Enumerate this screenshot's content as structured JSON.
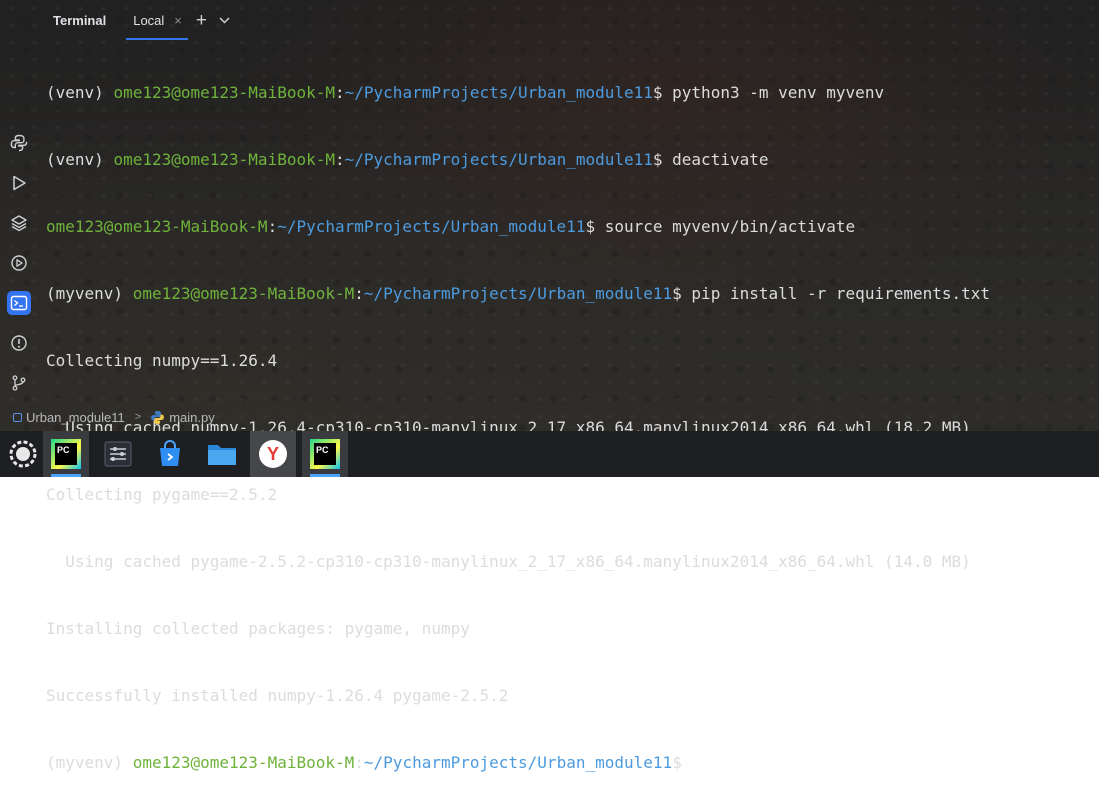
{
  "tabbar": {
    "title": "Terminal",
    "tab_label": "Local",
    "close": "×",
    "add": "+",
    "menu": "⌄"
  },
  "rail": {
    "icons": [
      "python-packages-icon",
      "run-icon",
      "layers-icon",
      "services-icon",
      "terminal-icon",
      "problems-icon",
      "git-icon"
    ],
    "active": "terminal-icon"
  },
  "terminal": {
    "lines": [
      {
        "env": "(venv) ",
        "user": "ome123@ome123-MaiBook-M",
        "sep": ":",
        "path": "~/PycharmProjects/Urban_module11",
        "cmd": "$ python3 -m venv myvenv"
      },
      {
        "env": "(venv) ",
        "user": "ome123@ome123-MaiBook-M",
        "sep": ":",
        "path": "~/PycharmProjects/Urban_module11",
        "cmd": "$ deactivate"
      },
      {
        "env": "",
        "user": "ome123@ome123-MaiBook-M",
        "sep": ":",
        "path": "~/PycharmProjects/Urban_module11",
        "cmd": "$ source myvenv/bin/activate"
      },
      {
        "env": "(myvenv) ",
        "user": "ome123@ome123-MaiBook-M",
        "sep": ":",
        "path": "~/PycharmProjects/Urban_module11",
        "cmd": "$ pip install -r requirements.txt"
      },
      {
        "text": "Collecting numpy==1.26.4"
      },
      {
        "text": "  Using cached numpy-1.26.4-cp310-cp310-manylinux_2_17_x86_64.manylinux2014_x86_64.whl (18.2 MB)"
      },
      {
        "text": "Collecting pygame==2.5.2"
      },
      {
        "text": "  Using cached pygame-2.5.2-cp310-cp310-manylinux_2_17_x86_64.manylinux2014_x86_64.whl (14.0 MB)"
      },
      {
        "text": "Installing collected packages: pygame, numpy"
      },
      {
        "text": "Successfully installed numpy-1.26.4 pygame-2.5.2"
      },
      {
        "env": "(myvenv) ",
        "user": "ome123@ome123-MaiBook-M",
        "sep": ":",
        "path": "~/PycharmProjects/Urban_module11",
        "cmd": "$"
      }
    ]
  },
  "breadcrumb": {
    "project": "Urban_module11",
    "arrow": ">",
    "file": "main.py"
  },
  "taskbar": {
    "items": [
      "system-menu-icon",
      "pycharm-icon",
      "settings-icon",
      "store-icon",
      "files-icon",
      "yandex-browser-icon",
      "pycharm-active-icon"
    ],
    "pc_label_1": "PC",
    "pc_label_2": "PC",
    "yandex_label": "Y"
  },
  "colors": {
    "user": "#6fb33a",
    "path": "#4d9bdf",
    "accent": "#3574f0"
  }
}
